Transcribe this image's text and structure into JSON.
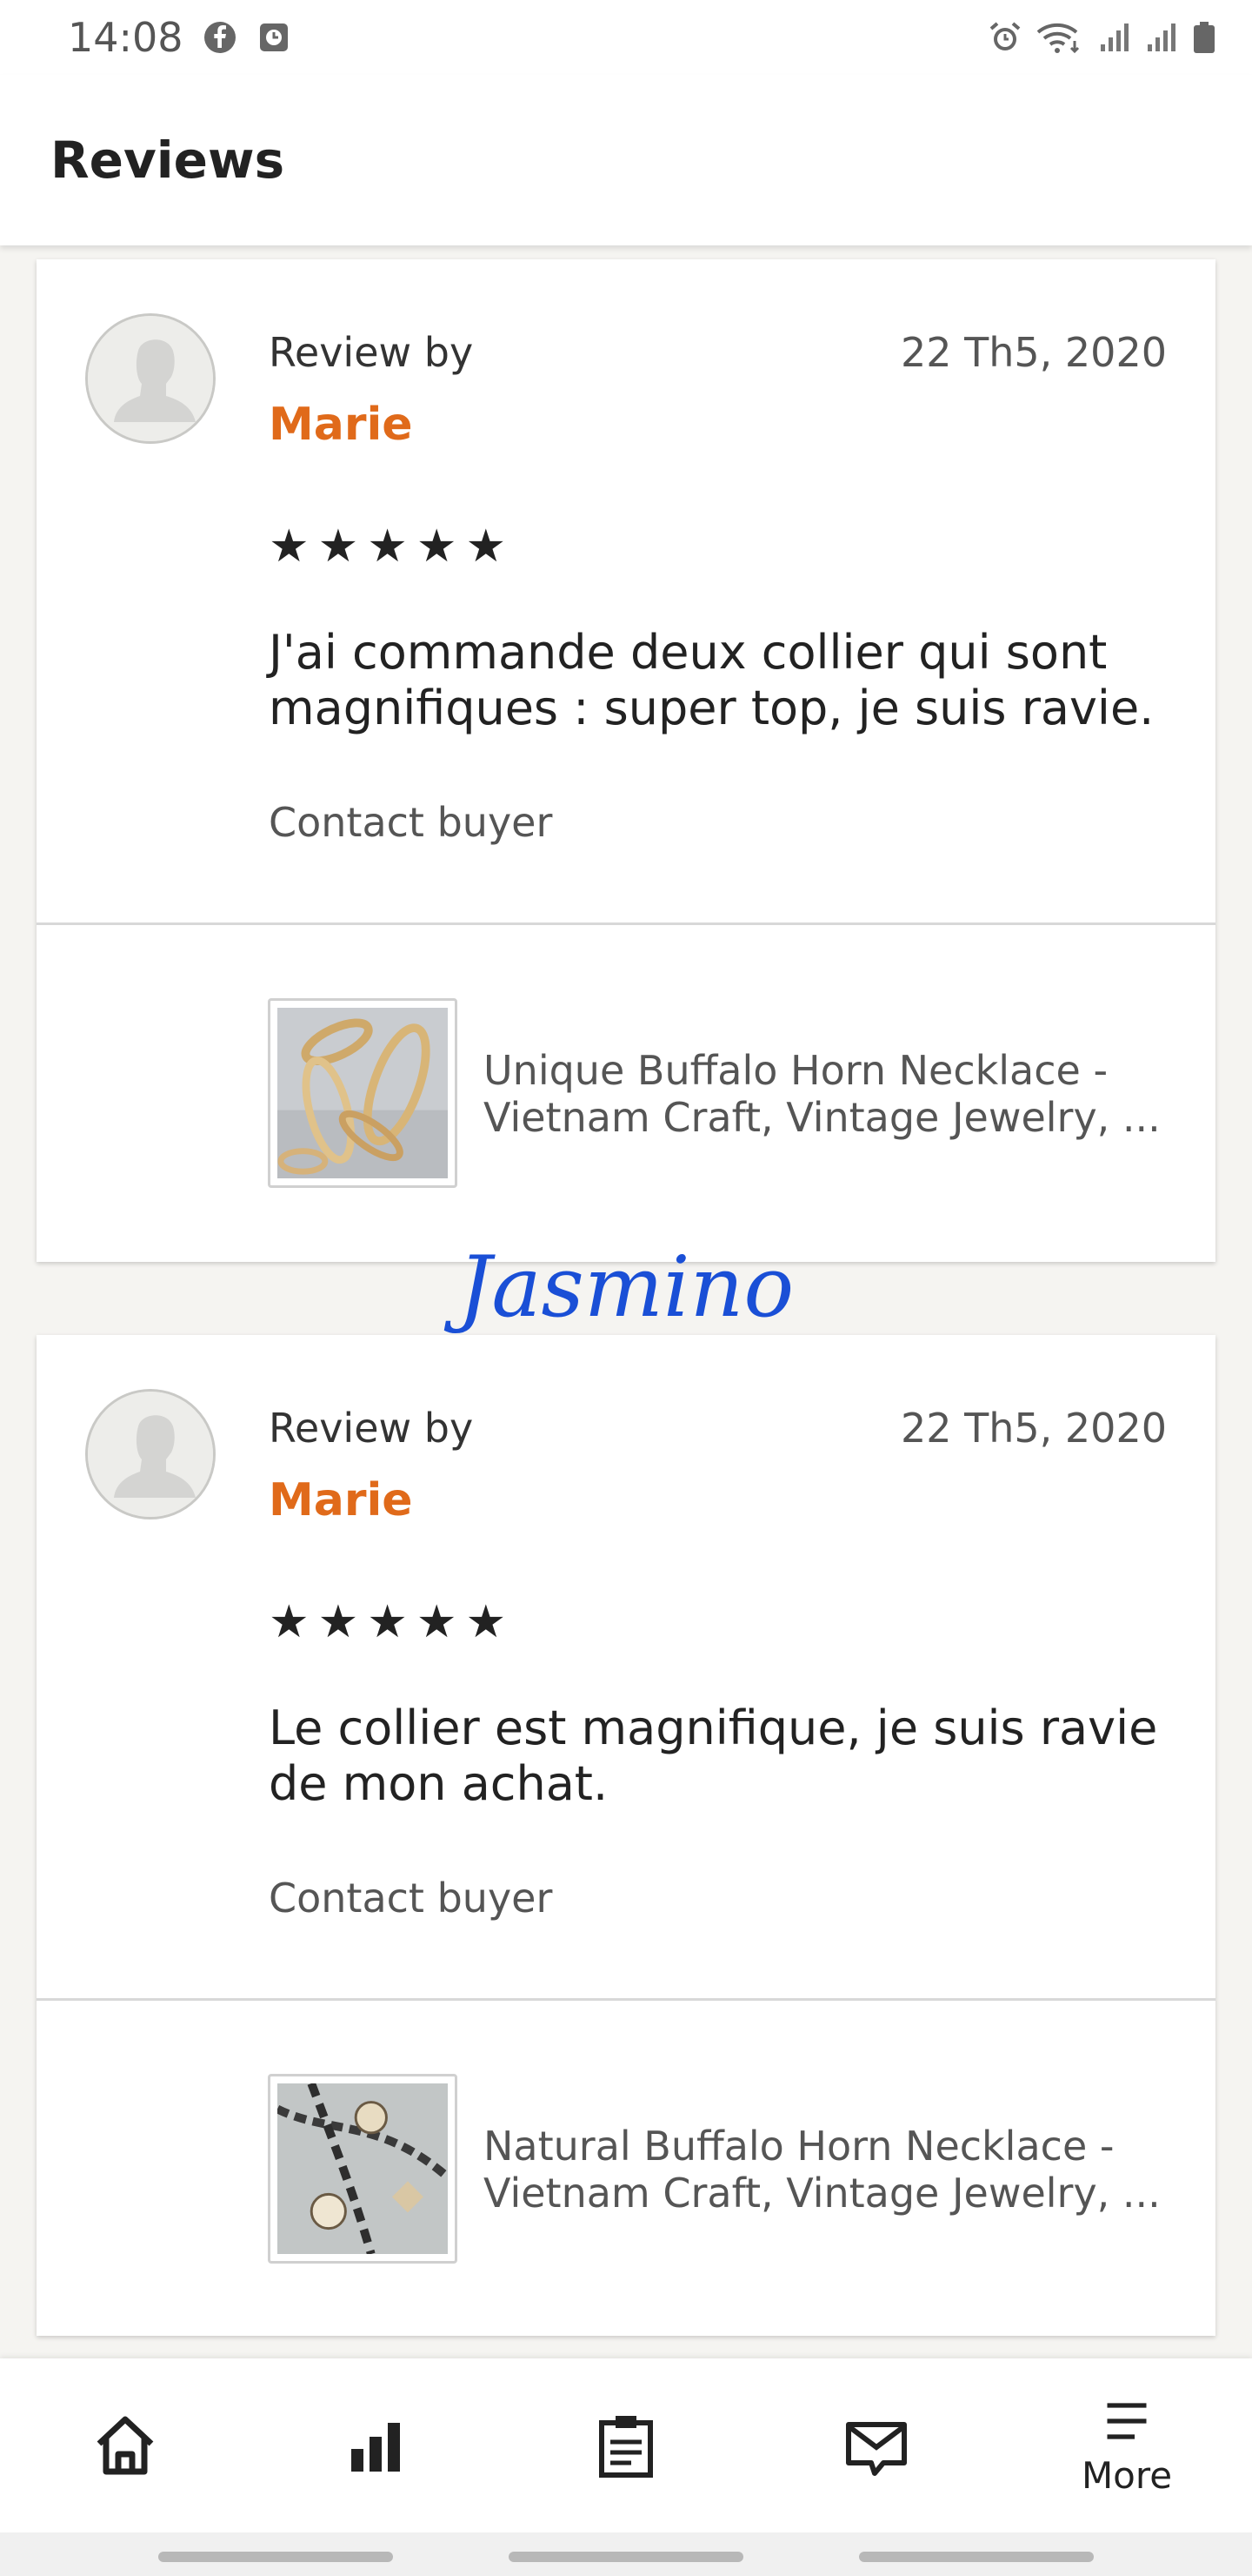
{
  "status_bar": {
    "time": "14:08",
    "left_icons": [
      "facebook-icon",
      "clock-app-icon"
    ],
    "right_icons": [
      "alarm-icon",
      "wifi-icon",
      "signal-icon",
      "signal-icon",
      "battery-icon"
    ]
  },
  "header": {
    "title": "Reviews"
  },
  "reviews": [
    {
      "review_by_label": "Review by",
      "reviewer": "Marie",
      "date": "22 Th5, 2020",
      "stars": "★★★★★",
      "rating": 5,
      "text": "J'ai commande deux collier qui sont magnifiques : super top, je suis ravie.",
      "contact_label": "Contact buyer",
      "product_title": "Unique Buffalo Horn Necklace - Vietnam Craft, Vintage Jewelry, ..."
    },
    {
      "review_by_label": "Review by",
      "reviewer": "Marie",
      "date": "22 Th5, 2020",
      "stars": "★★★★★",
      "rating": 5,
      "text": "Le collier est magnifique, je suis ravie de mon achat.",
      "contact_label": "Contact buyer",
      "product_title": "Natural Buffalo Horn Necklace - Vietnam Craft, Vintage Jewelry, ..."
    }
  ],
  "watermark": "Jasmino",
  "bottom_nav": {
    "items": [
      "home-icon",
      "stats-icon",
      "orders-icon",
      "messages-icon",
      "menu-icon"
    ],
    "more_label": "More"
  },
  "colors": {
    "accent": "#e06a1a",
    "watermark": "#1a4fd6",
    "background": "#f5f4f1"
  }
}
